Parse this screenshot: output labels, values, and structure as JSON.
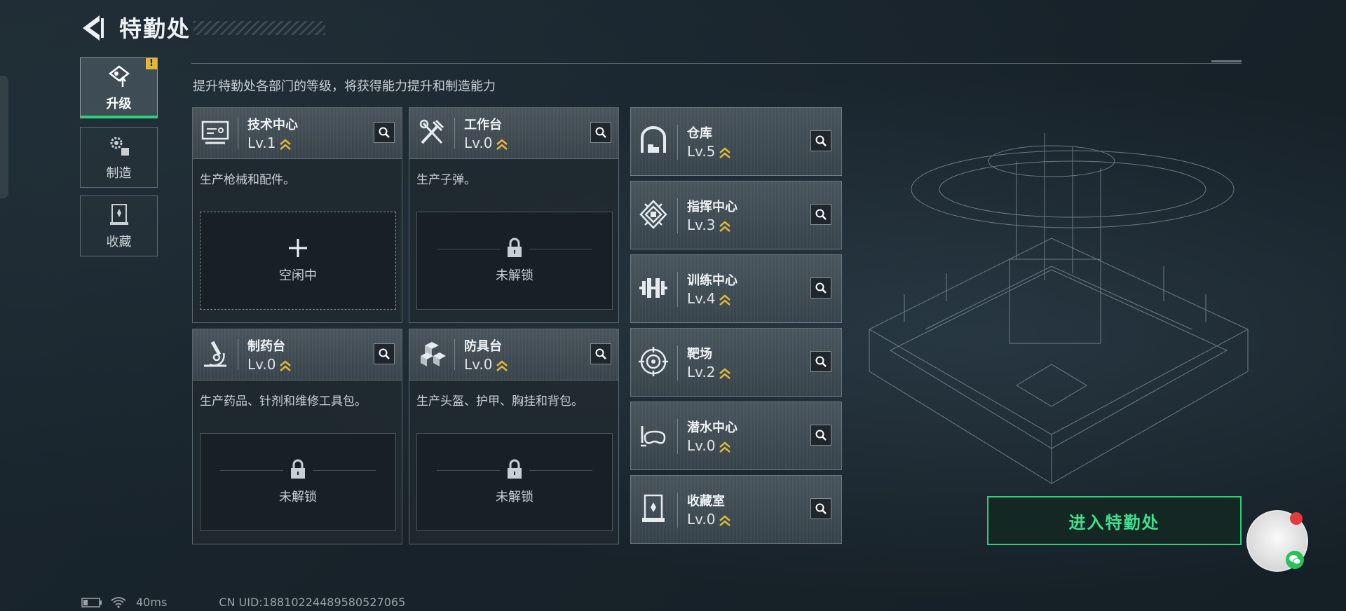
{
  "header": {
    "title": "特勤处",
    "subtitle": "提升特勤处各部门的等级，将获得能力提升和制造能力"
  },
  "nav": {
    "tabs": [
      {
        "label": "升级",
        "icon": "upgrade-icon",
        "active": true,
        "alert": "!"
      },
      {
        "label": "制造",
        "icon": "gears-icon",
        "active": false
      },
      {
        "label": "收藏",
        "icon": "collection-icon",
        "active": false
      }
    ]
  },
  "departments": [
    {
      "name": "技术中心",
      "level": "Lv.1",
      "icon": "monitor-icon",
      "desc": "生产枪械和配件。",
      "slot": "空闲中",
      "slot_state": "idle"
    },
    {
      "name": "工作台",
      "level": "Lv.0",
      "icon": "tools-icon",
      "desc": "生产子弹。",
      "slot": "未解锁",
      "slot_state": "locked"
    },
    {
      "name": "制药台",
      "level": "Lv.0",
      "icon": "microscope-icon",
      "desc": "生产药品、针剂和维修工具包。",
      "slot": "未解锁",
      "slot_state": "locked"
    },
    {
      "name": "防具台",
      "level": "Lv.0",
      "icon": "armor-blocks-icon",
      "desc": "生产头盔、护甲、胸挂和背包。",
      "slot": "未解锁",
      "slot_state": "locked"
    }
  ],
  "facilities": [
    {
      "name": "仓库",
      "level": "Lv.5",
      "icon": "warehouse-icon"
    },
    {
      "name": "指挥中心",
      "level": "Lv.3",
      "icon": "chip-icon"
    },
    {
      "name": "训练中心",
      "level": "Lv.4",
      "icon": "dumbbell-icon"
    },
    {
      "name": "靶场",
      "level": "Lv.2",
      "icon": "target-icon"
    },
    {
      "name": "潜水中心",
      "level": "Lv.0",
      "icon": "diving-mask-icon"
    },
    {
      "name": "收藏室",
      "level": "Lv.0",
      "icon": "display-case-icon"
    }
  ],
  "enter_button": "进入特勤处",
  "status": {
    "ping": "40ms",
    "uid": "CN UID:18810224489580527065"
  },
  "colors": {
    "accent": "#2bd07c",
    "level_chevron": "#e0b93a",
    "alert": "#e0b93a"
  }
}
